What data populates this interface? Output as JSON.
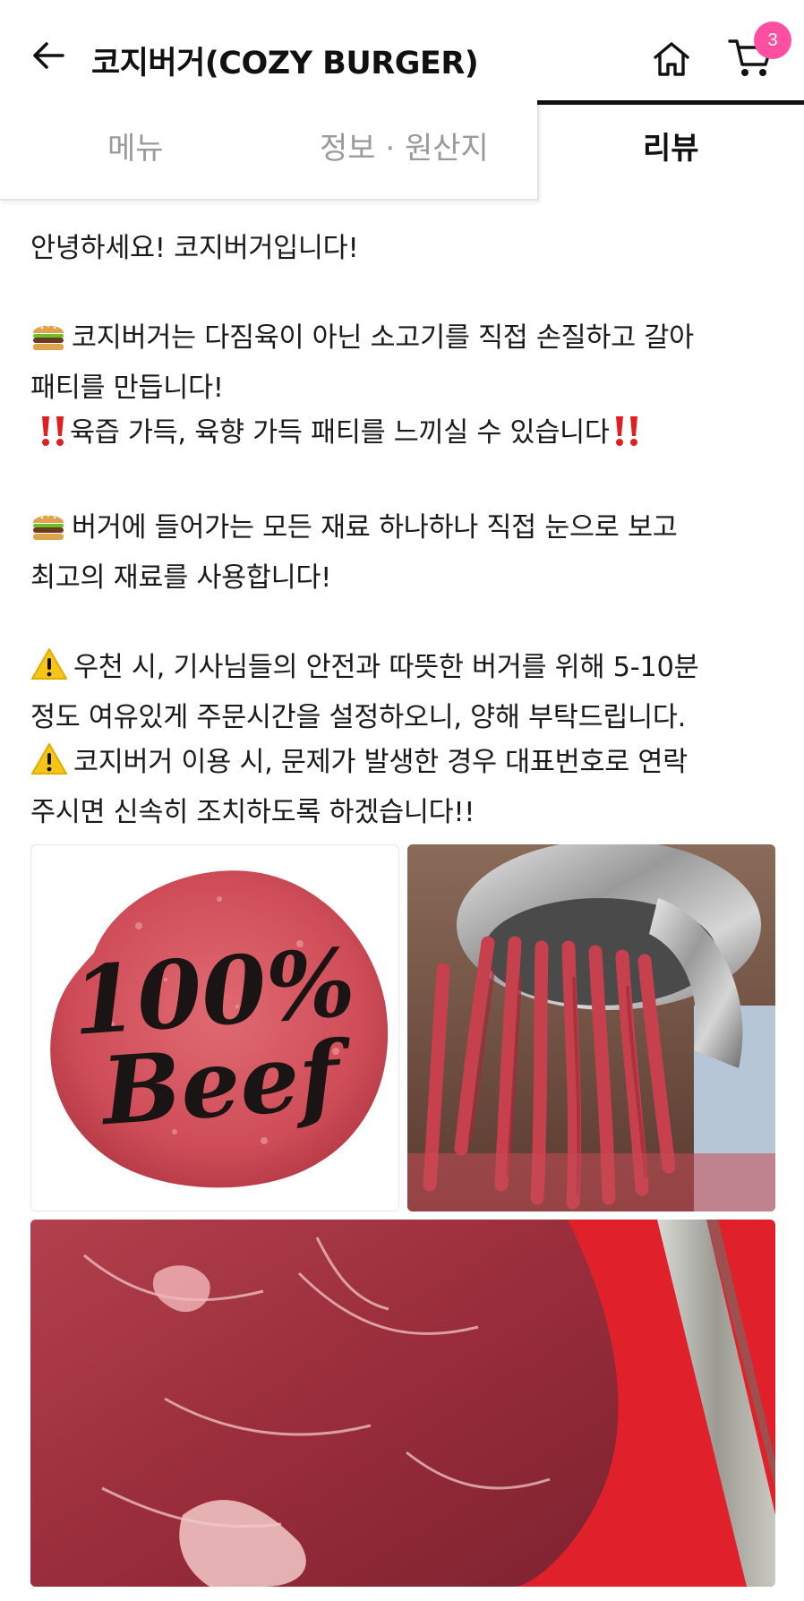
{
  "header": {
    "title": "코지버거(COZY BURGER)",
    "cart_count": "3",
    "back_icon": "arrow-left-icon",
    "home_icon": "home-icon",
    "cart_icon": "cart-icon",
    "badge_color": "#ff4fa0"
  },
  "tabs": [
    {
      "label": "메뉴",
      "active": false
    },
    {
      "label": "정보 · 원산지",
      "active": false
    },
    {
      "label": "리뷰",
      "active": true
    }
  ],
  "notice": {
    "line1": "안녕하세요! 코지버거입니다!",
    "line2": "코지버거는 다짐육이 아닌 소고기를 직접 손질하고 갈아",
    "line3": "패티를 만듭니다!",
    "line4": "육즙 가득, 육향 가득 패티를 느끼실 수 있습니다",
    "line5": "버거에 들어가는 모든 재료 하나하나 직접 눈으로 보고",
    "line6": "최고의 재료를 사용합니다!",
    "line7": "우천 시, 기사님들의 안전과 따뜻한 버거를 위해 5-10분",
    "line8": "정도 여유있게 주문시간을 설정하오니, 양해 부탁드립니다.",
    "line9": "코지버거 이용 시,  문제가 발생한 경우 대표번호로 연락",
    "line10": "주시면 신속히 조치하도록 하겠습니다!!"
  },
  "photos": {
    "beef_patty_text_line1": "100%",
    "beef_patty_text_line2": "Beef"
  }
}
